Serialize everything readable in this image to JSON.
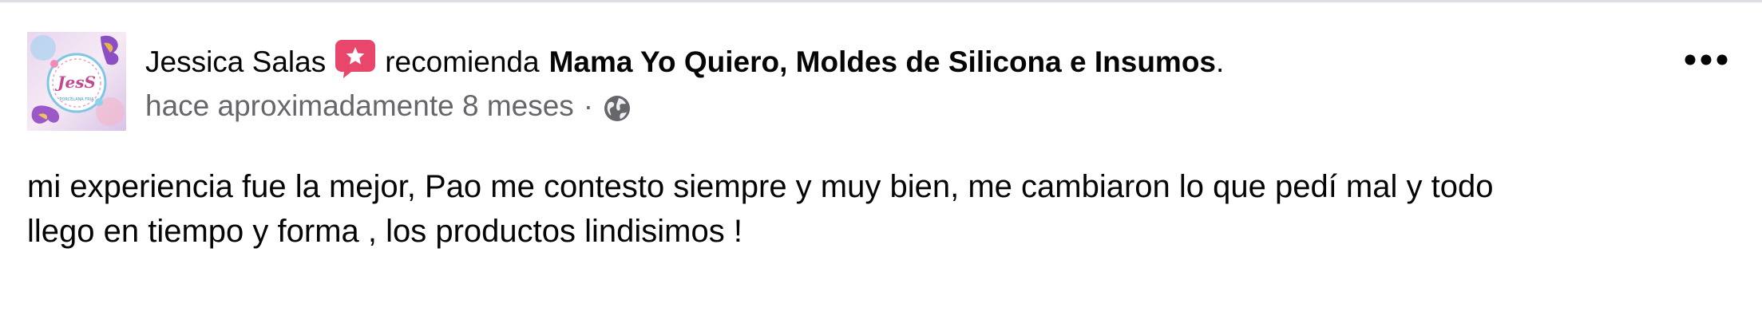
{
  "post": {
    "author": "Jessica Salas",
    "action": "recomienda",
    "page_name": "Mama Yo Quiero, Moldes de Silicona e Insumos",
    "period": ".",
    "timestamp": "hace aproximadamente 8 meses",
    "separator": "·",
    "privacy_icon": "globe-icon",
    "recommend_icon": "recommend-star-icon",
    "more_icon": "more-options-icon",
    "body_line1": "mi experiencia fue la mejor, Pao me contesto siempre y muy bien, me cambiaron lo que pedí mal y todo",
    "body_line2": "llego en tiempo y forma , los productos lindisimos !"
  },
  "avatar": {
    "logo_text": "JesS",
    "logo_subtext": "PORCELANA FRIA"
  },
  "colors": {
    "text_primary": "#050505",
    "text_secondary": "#65676b",
    "recommend_badge": "#e8466a",
    "divider": "#dadde1"
  }
}
